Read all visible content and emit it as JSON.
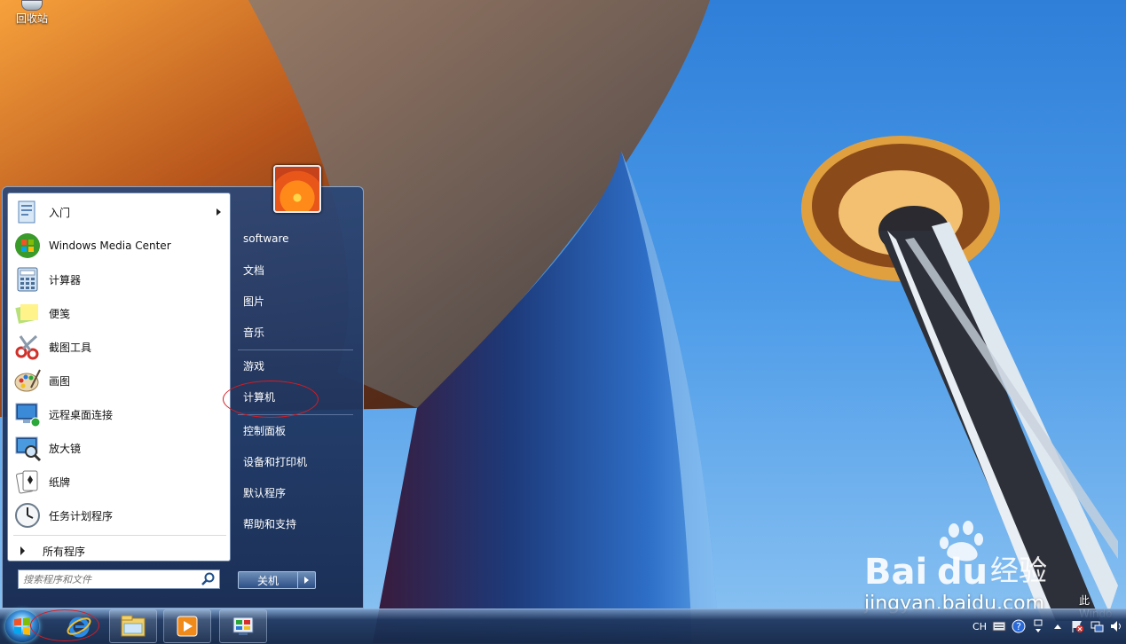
{
  "desktop": {
    "recycle_bin_label": "回收站",
    "watermark_brand": "Bai",
    "watermark_brand_du": "du",
    "watermark_jingyan": "经验",
    "watermark_domain": "jingyan.baidu.com",
    "activation_fragment": "此 Windo"
  },
  "start_menu": {
    "programs": [
      {
        "label": "入门",
        "icon": "getting-started-icon",
        "has_submenu": true
      },
      {
        "label": "Windows Media Center",
        "icon": "media-center-icon",
        "has_submenu": false
      },
      {
        "label": "计算器",
        "icon": "calculator-icon",
        "has_submenu": false
      },
      {
        "label": "便笺",
        "icon": "sticky-notes-icon",
        "has_submenu": false
      },
      {
        "label": "截图工具",
        "icon": "snipping-tool-icon",
        "has_submenu": false
      },
      {
        "label": "画图",
        "icon": "paint-icon",
        "has_submenu": false
      },
      {
        "label": "远程桌面连接",
        "icon": "remote-desktop-icon",
        "has_submenu": false
      },
      {
        "label": "放大镜",
        "icon": "magnifier-icon",
        "has_submenu": false
      },
      {
        "label": "纸牌",
        "icon": "solitaire-icon",
        "has_submenu": false
      },
      {
        "label": "任务计划程序",
        "icon": "task-scheduler-icon",
        "has_submenu": false
      }
    ],
    "all_programs": "所有程序",
    "search_placeholder": "搜索程序和文件",
    "right_items": [
      {
        "label": "software"
      },
      {
        "label": "文档"
      },
      {
        "label": "图片"
      },
      {
        "label": "音乐"
      },
      {
        "label": "游戏"
      },
      {
        "label": "计算机"
      },
      {
        "label": "控制面板"
      },
      {
        "label": "设备和打印机"
      },
      {
        "label": "默认程序"
      },
      {
        "label": "帮助和支持"
      }
    ],
    "shutdown_label": "关机"
  },
  "taskbar": {
    "pinned": [
      "internet-explorer-icon",
      "windows-explorer-icon",
      "media-player-icon",
      "control-panel-icon"
    ],
    "tray": {
      "language": "CH"
    }
  },
  "colors": {
    "annotation": "#d81b22",
    "menu_dark": "#1b3566"
  }
}
